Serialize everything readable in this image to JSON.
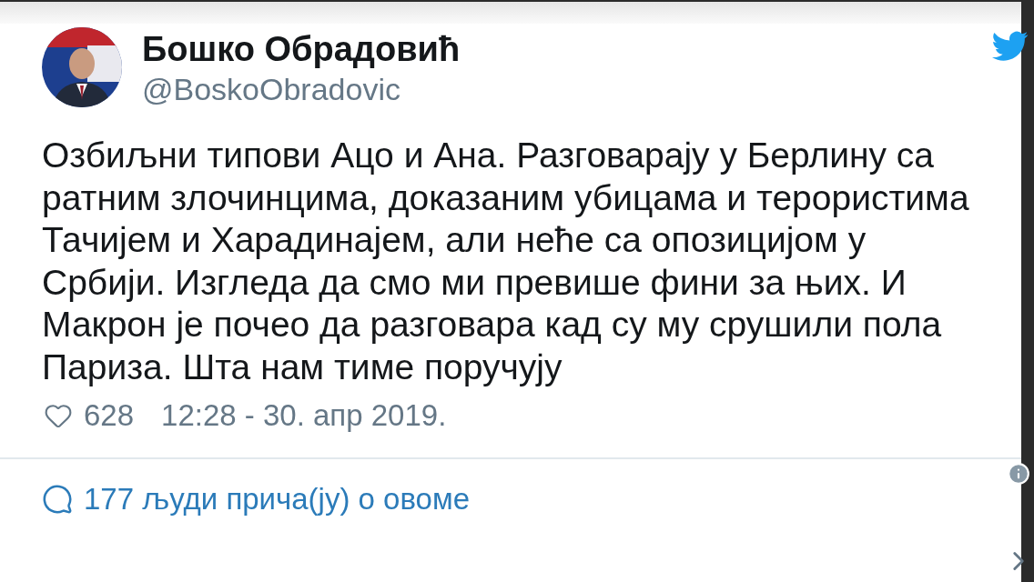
{
  "author": {
    "name": "Бошко Обрадовић",
    "handle": "@BoskoObradovic"
  },
  "text": "Озбиљни типови Ацо и Ана. Разговарају у Берлину са ратним злочинцима, доказаним убицама и терористима Тачијем и Харадинајем, али неће са опозицијом у Србији. Изгледа да смо ми превише фини за њих. И Макрон је почео да разговара кад су му срушили пола Париза. Шта нам тиме поручују",
  "likes": "628",
  "timestamp": "12:28 - 30. апр 2019.",
  "conversation": "177 људи прича(ју) о овоме"
}
